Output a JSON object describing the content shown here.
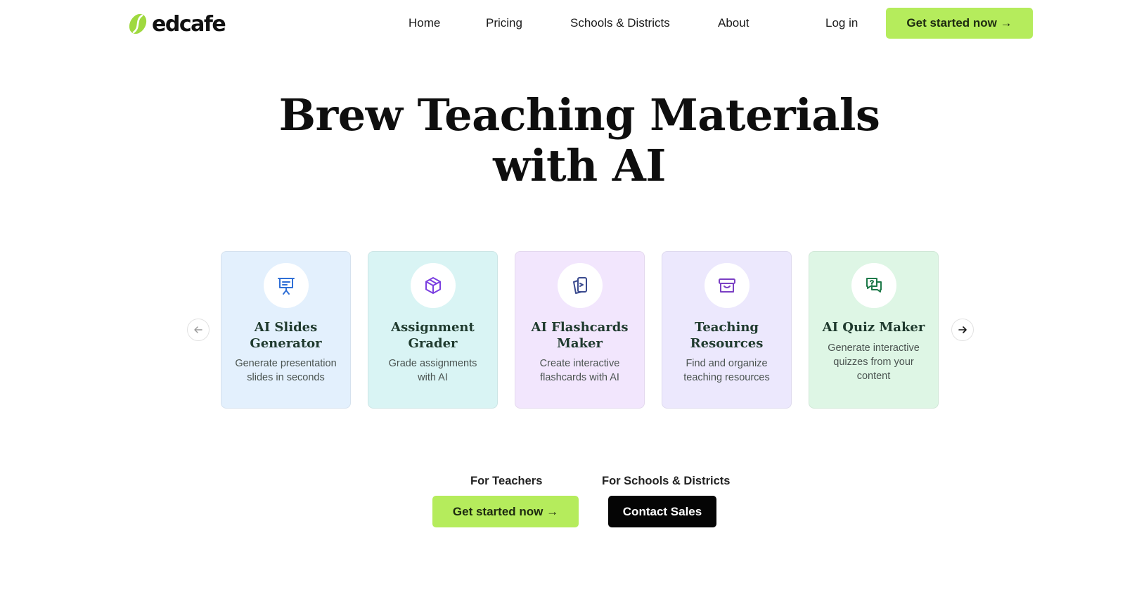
{
  "header": {
    "logo_text": "edcafe",
    "nav": [
      {
        "label": "Home"
      },
      {
        "label": "Pricing"
      },
      {
        "label": "Schools & Districts"
      },
      {
        "label": "About"
      }
    ],
    "login_label": "Log in",
    "cta_label": "Get started now →"
  },
  "hero": {
    "title_line1": "Brew Teaching Materials",
    "title_line2": "with AI"
  },
  "carousel": {
    "prev_icon": "arrow-left-icon",
    "next_icon": "arrow-right-icon",
    "cards": [
      {
        "title_line1": "AI Slides",
        "title_line2": "Generator",
        "desc_line1": "Generate presentation",
        "desc_line2": "slides in seconds",
        "icon": "presentation-board-icon",
        "bg": "#e3f0fd",
        "icon_color": "#2f6fd6"
      },
      {
        "title_line1": "Assignment",
        "title_line2": "Grader",
        "desc_line1": "Grade assignments",
        "desc_line2": "with AI",
        "icon": "cube-icon",
        "bg": "#d9f4f4",
        "icon_color": "#7b3fe0"
      },
      {
        "title_line1": "AI Flashcards",
        "title_line2": "Maker",
        "desc_line1": "Create interactive",
        "desc_line2": "flashcards with AI",
        "icon": "flashcards-icon",
        "bg": "#f2e6fd",
        "icon_color": "#3a4a8e"
      },
      {
        "title_line1": "Teaching",
        "title_line2": "Resources",
        "desc_line1": "Find and organize",
        "desc_line2": "teaching resources",
        "icon": "archive-box-icon",
        "bg": "#ece8fd",
        "icon_color": "#7b3fc4"
      },
      {
        "title_line1": "AI Quiz Maker",
        "desc_line1": "Generate interactive",
        "desc_line2": "quizzes from your",
        "desc_line3": "content",
        "icon": "quiz-chat-icon",
        "bg": "#def6e5",
        "icon_color": "#1f7a4a"
      }
    ]
  },
  "ctas": {
    "teachers_label": "For Teachers",
    "teachers_button": "Get started now →",
    "schools_label": "For Schools & Districts",
    "schools_button": "Contact Sales"
  },
  "colors": {
    "accent_green": "#b5ec5c",
    "dark": "#050505"
  }
}
